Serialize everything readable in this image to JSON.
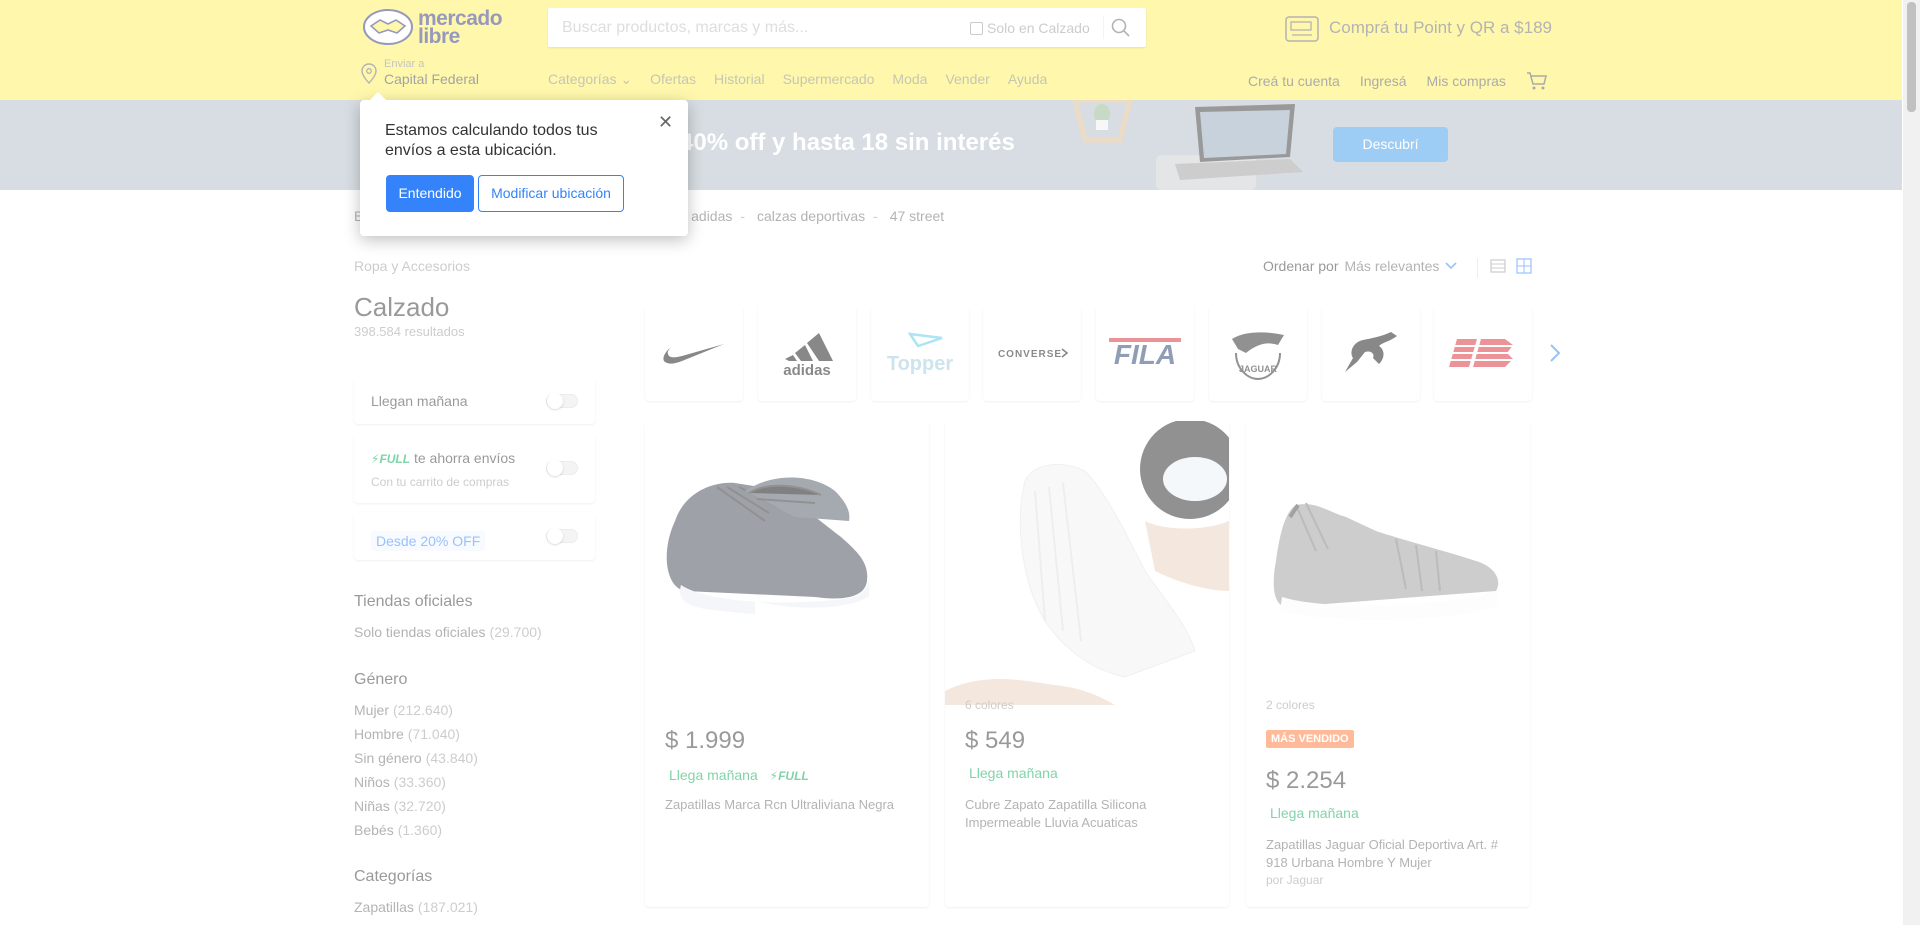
{
  "header": {
    "logo_text_1": "mercado",
    "logo_text_2": "libre",
    "search_placeholder": "Buscar productos, marcas y más...",
    "search_only_label": "Solo en Calzado",
    "promo_text": "Comprá tu Point y QR a $189",
    "location_small": "Enviar a",
    "location_big": "Capital Federal",
    "nav": [
      "Categorías",
      "Ofertas",
      "Historial",
      "Supermercado",
      "Moda",
      "Vender",
      "Ayuda"
    ],
    "nav_right": [
      "Creá tu cuenta",
      "Ingresá",
      "Mis compras"
    ]
  },
  "banner": {
    "text": "a 40% off y hasta 18 sin interés",
    "button": "Descubrí",
    "color": "#afbac4"
  },
  "popup": {
    "text": "Estamos calculando todos tus envíos a esta ubicación.",
    "primary": "Entendido",
    "secondary": "Modificar ubicación"
  },
  "breadcrumb": [
    "B",
    "adidas",
    "calzas deportivas",
    "47 street"
  ],
  "left": {
    "category": "Ropa y Accesorios",
    "title": "Calzado",
    "results": "398.584 resultados",
    "toggle_1": "Llegan mañana",
    "full_tag": "FULL",
    "full_text": "te ahorra envíos",
    "full_small": "Con tu carrito de compras",
    "discount": "Desde 20% OFF",
    "sections": {
      "tiendas": "Tiendas oficiales",
      "genero": "Género",
      "categorias": "Categorías"
    },
    "tiendas_items": [
      {
        "label": "Solo tiendas oficiales",
        "count": "(29.700)"
      }
    ],
    "genero_items": [
      {
        "label": "Mujer",
        "count": "(212.640)"
      },
      {
        "label": "Hombre",
        "count": "(71.040)"
      },
      {
        "label": "Sin género",
        "count": "(43.840)"
      },
      {
        "label": "Niños",
        "count": "(33.360)"
      },
      {
        "label": "Niñas",
        "count": "(32.720)"
      },
      {
        "label": "Bebés",
        "count": "(1.360)"
      }
    ],
    "categorias_items": [
      {
        "label": "Zapatillas",
        "count": "(187.021)"
      }
    ]
  },
  "sort": {
    "label": "Ordenar por",
    "value": "Más relevantes"
  },
  "brands": [
    "nike",
    "adidas",
    "Topper",
    "CONVERSE",
    "FILA",
    "JAGUAR",
    "puma",
    "new balance"
  ],
  "products": [
    {
      "price": "$ 1.999",
      "shipping": "Llega mañana",
      "full": "FULL",
      "title": "Zapatillas Marca Rcn Ultraliviana Negra"
    },
    {
      "colors": "6 colores",
      "price": "$ 549",
      "shipping": "Llega mañana",
      "title": "Cubre Zapato Zapatilla Silicona Impermeable Lluvia Acuaticas"
    },
    {
      "colors": "2 colores",
      "badge": "MÁS VENDIDO",
      "price": "$ 2.254",
      "shipping": "Llega mañana",
      "title": "Zapatillas Jaguar Oficial Deportiva Art. # 918 Urbana Hombre Y Mujer",
      "seller": "por Jaguar"
    }
  ],
  "colors": {
    "header_yellow": "#fff159",
    "brand_blue": "#3483fa",
    "green": "#00a650"
  }
}
